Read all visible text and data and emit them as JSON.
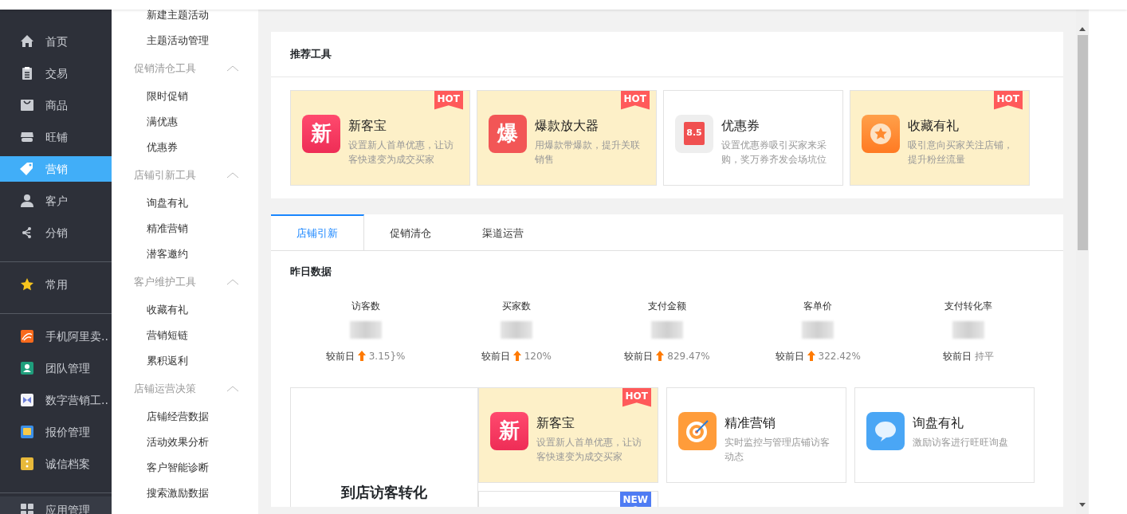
{
  "sidebar": {
    "groups": [
      {
        "items": [
          {
            "label": "首页",
            "selected": false
          },
          {
            "label": "交易",
            "selected": false
          },
          {
            "label": "商品",
            "selected": false
          },
          {
            "label": "旺铺",
            "selected": false
          },
          {
            "label": "营销",
            "selected": true
          },
          {
            "label": "客户",
            "selected": false
          },
          {
            "label": "分销",
            "selected": false
          }
        ]
      },
      {
        "items": [
          {
            "label": "常用",
            "selected": false
          }
        ]
      },
      {
        "items": [
          {
            "label": "手机阿里卖..",
            "selected": false
          },
          {
            "label": "团队管理",
            "selected": false
          },
          {
            "label": "数字营销工..",
            "selected": false
          },
          {
            "label": "报价管理",
            "selected": false
          },
          {
            "label": "诚信档案",
            "selected": false
          }
        ]
      }
    ],
    "bottom_item": {
      "label": "应用管理"
    }
  },
  "submenu": [
    {
      "kind": "item",
      "label": "新建主题活动"
    },
    {
      "kind": "item",
      "label": "主题活动管理"
    },
    {
      "kind": "section",
      "label": "促销清仓工具",
      "expanded": true,
      "children": [
        {
          "label": "限时促销"
        },
        {
          "label": "满优惠"
        },
        {
          "label": "优惠券"
        }
      ]
    },
    {
      "kind": "section",
      "label": "店铺引新工具",
      "expanded": true,
      "children": [
        {
          "label": "询盘有礼"
        },
        {
          "label": "精准营销"
        },
        {
          "label": "潜客邀约"
        }
      ]
    },
    {
      "kind": "section",
      "label": "客户维护工具",
      "expanded": true,
      "children": [
        {
          "label": "收藏有礼"
        },
        {
          "label": "营销短链"
        },
        {
          "label": "累积返利"
        }
      ]
    },
    {
      "kind": "section",
      "label": "店铺运营决策",
      "expanded": true,
      "children": [
        {
          "label": "店铺经营数据"
        },
        {
          "label": "活动效果分析"
        },
        {
          "label": "客户智能诊断"
        },
        {
          "label": "搜索激励数据"
        }
      ]
    }
  ],
  "recommended": {
    "title": "推荐工具",
    "tools": [
      {
        "kind": "character",
        "name": "新客宝",
        "desc": "设置新人首单优惠，让访客快速变为成交买家",
        "badge": "HOT",
        "highlighted": true,
        "icon_text": "新"
      },
      {
        "kind": "character",
        "name": "爆款放大器",
        "desc": "用爆款带爆款，提升关联销售",
        "badge": "HOT",
        "highlighted": true,
        "icon_text": "爆"
      },
      {
        "kind": "coupon",
        "name": "优惠券",
        "desc": "设置优惠券吸引买家来采购，奖万券齐发会场坑位",
        "highlighted": false,
        "icon_text": "8.5"
      },
      {
        "kind": "star",
        "name": "收藏有礼",
        "desc": "吸引意向买家关注店铺，提升粉丝流量",
        "badge": "HOT",
        "highlighted": true
      }
    ]
  },
  "tabs": [
    {
      "label": "店铺引新",
      "selected": true
    },
    {
      "label": "促销清仓",
      "selected": false
    },
    {
      "label": "渠道运营",
      "selected": false
    }
  ],
  "yesterday": {
    "title": "昨日数据",
    "metrics": [
      {
        "label": "访客数",
        "compare": "较前日",
        "increased": true,
        "change": "3.15}%"
      },
      {
        "label": "买家数",
        "compare": "较前日",
        "increased": true,
        "change": "120%"
      },
      {
        "label": "支付金额",
        "compare": "较前日",
        "increased": true,
        "change": "829.47%"
      },
      {
        "label": "客单价",
        "compare": "较前日",
        "increased": true,
        "change": "322.42%"
      },
      {
        "label": "支付转化率",
        "compare": "较前日",
        "increased": false,
        "change": "持平"
      }
    ]
  },
  "conversion": {
    "title": "到店访客转化",
    "tools": [
      {
        "kind": "character",
        "name": "新客宝",
        "desc": "设置新人首单优惠，让访客快速变为成交买家",
        "badge": "HOT",
        "highlighted": true,
        "icon_text": "新"
      },
      {
        "kind": "target",
        "name": "精准营销",
        "desc": "实时监控与管理店铺访客动态",
        "highlighted": false
      },
      {
        "kind": "chat",
        "name": "询盘有礼",
        "desc": "激励访客进行旺旺询盘",
        "highlighted": false
      }
    ],
    "more_badge": "NEW"
  }
}
